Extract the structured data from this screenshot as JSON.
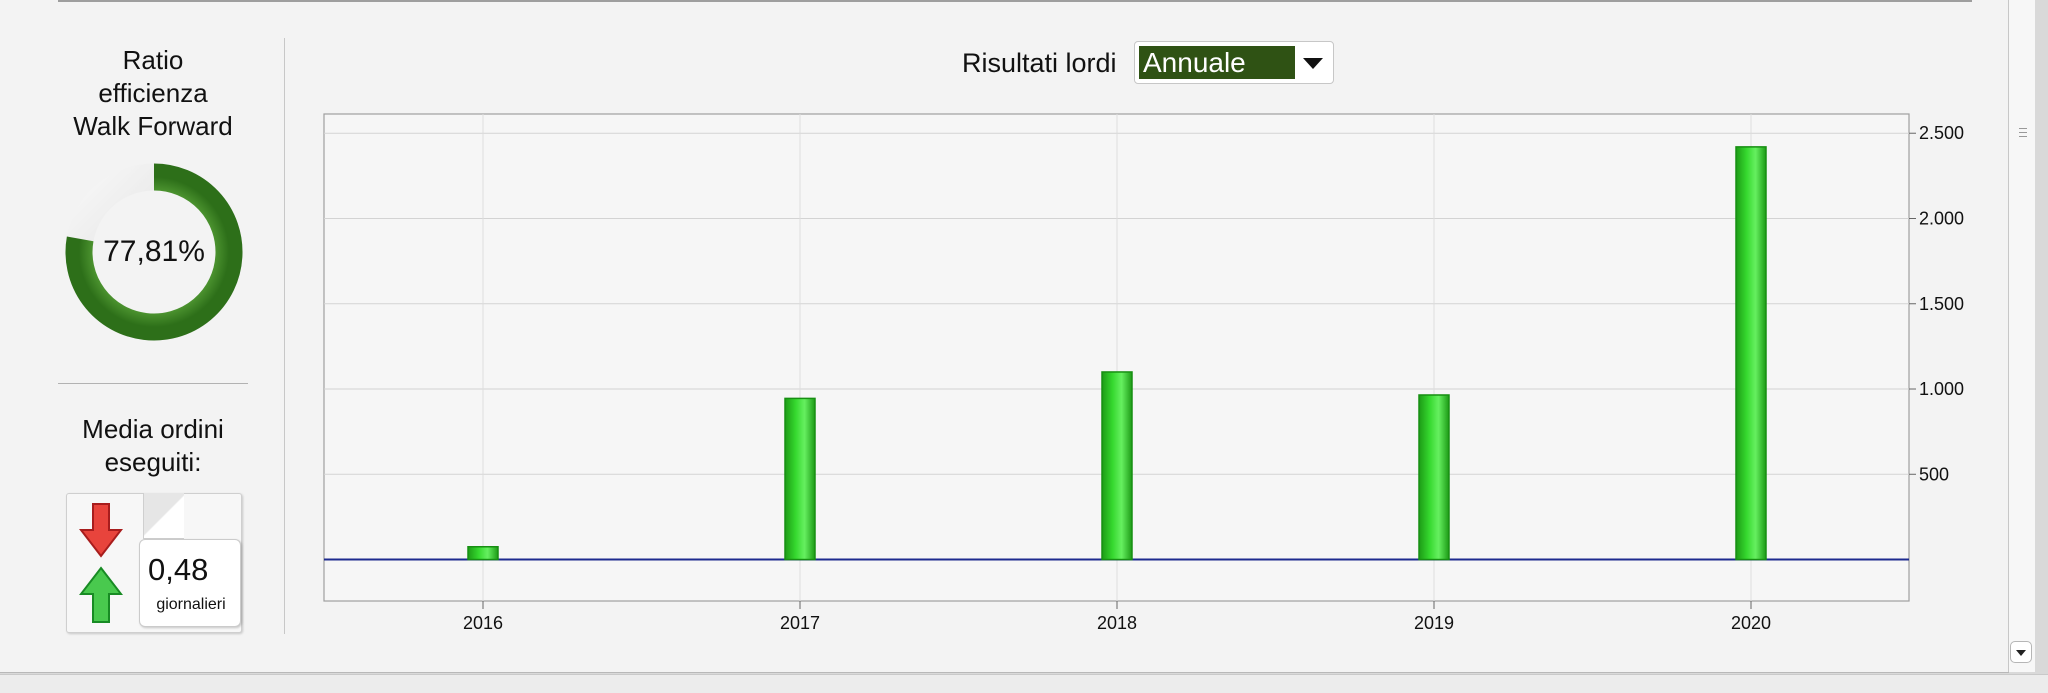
{
  "left_panel": {
    "ratio_title": "Ratio\nefficienza\nWalk Forward",
    "ratio_value": "77,81%",
    "ratio_fraction": 0.7781,
    "orders_title": "Media ordini\neseguiti:",
    "orders_value": "0,48",
    "orders_unit": "giornalieri",
    "icons": {
      "down": "red-down-arrow-icon",
      "up": "green-up-arrow-icon"
    }
  },
  "chart_header": {
    "title": "Risultati lordi",
    "selected_period": "Annuale"
  },
  "colors": {
    "bar": "#35d82e",
    "bar_dark": "#1d9b16",
    "ring": "#4f9630",
    "ring_track": "#e4e4e4",
    "select_bg": "#2f5214",
    "baseline": "#1d2b8f"
  },
  "chart_data": {
    "type": "bar",
    "categories": [
      "2016",
      "2017",
      "2018",
      "2019",
      "2020"
    ],
    "values": [
      75,
      945,
      1100,
      965,
      2420
    ],
    "y_ticks": [
      "500",
      "1.000",
      "1.500",
      "2.000",
      "2.500"
    ],
    "y_tick_values": [
      500,
      1000,
      1500,
      2000,
      2500
    ],
    "ylim": [
      -120,
      2560
    ],
    "grid": true,
    "y_axis_side": "right",
    "xlabel": "",
    "ylabel": ""
  }
}
